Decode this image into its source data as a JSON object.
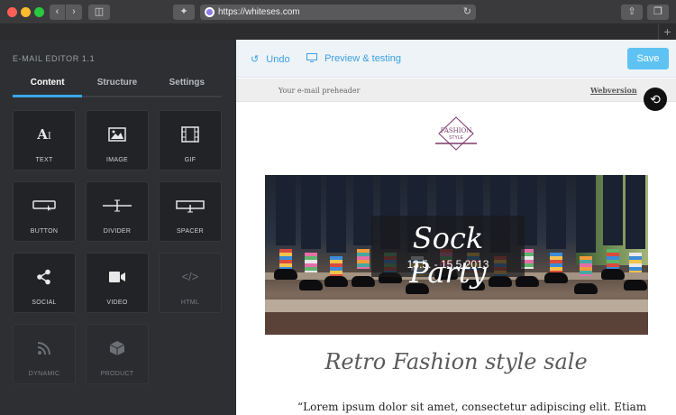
{
  "browser": {
    "url": "https://whiteses.com",
    "new_tab_glyph": "+"
  },
  "panel": {
    "title": "E-MAIL EDITOR 1.1",
    "tabs": [
      {
        "label": "Content"
      },
      {
        "label": "Structure"
      },
      {
        "label": "Settings"
      }
    ],
    "tiles": [
      {
        "label": "TEXT",
        "icon": "text-icon"
      },
      {
        "label": "IMAGE",
        "icon": "image-icon"
      },
      {
        "label": "GIF",
        "icon": "gif-icon"
      },
      {
        "label": "BUTTON",
        "icon": "button-icon"
      },
      {
        "label": "DIVIDER",
        "icon": "divider-icon"
      },
      {
        "label": "SPACER",
        "icon": "spacer-icon"
      },
      {
        "label": "SOCIAL",
        "icon": "share-icon"
      },
      {
        "label": "VIDEO",
        "icon": "video-icon"
      },
      {
        "label": "HTML",
        "icon": "code-icon"
      },
      {
        "label": "DYNAMIC",
        "icon": "rss-icon"
      },
      {
        "label": "PRODUCT",
        "icon": "box-icon"
      }
    ]
  },
  "toolbar": {
    "undo_label": "Undo",
    "preview_label": "Preview & testing",
    "save_label": "Save"
  },
  "email": {
    "preheader": "Your e-mail preheader",
    "webversion": "Webversion",
    "logo_line1": "FASHION",
    "logo_line2": "STYLE",
    "hero_title": "Sock Party",
    "hero_date": "13.5. - 15.5.2013",
    "headline": "Retro Fashion style sale",
    "body": "“Lorem ipsum dolor sit amet, consectetur adipiscing elit. Etiam"
  },
  "colors": {
    "accent": "#3aa0e3",
    "save_button": "#5ec3f2",
    "panel_bg": "#2d2f32"
  }
}
